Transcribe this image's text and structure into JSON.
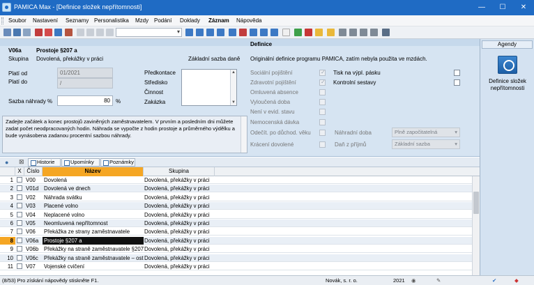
{
  "window": {
    "title": "PAMICA Max - [Definice složek nepřítomnosti]",
    "minimize": "—",
    "maximize": "☐",
    "close": "✕"
  },
  "menu": [
    "Soubor",
    "Nastavení",
    "Seznamy",
    "Personalistika",
    "Mzdy",
    "Podání",
    "Doklady",
    "Záznam",
    "Nápověda"
  ],
  "menu_bold_index": 7,
  "form": {
    "code": "V06a",
    "name": "Prostoje §207 a",
    "group_label": "Skupina",
    "group_value": "Dovolená, překážky v práci",
    "base_label": "Základní sazba daně",
    "definition_heading": "Definice",
    "definition_text": "Originální definice programu PAMICA, zatím nebyla použita ve mzdách.",
    "valid_from_label": "Platí od",
    "valid_from_value": "01/2021",
    "valid_to_label": "Platí do",
    "valid_to_value": "/",
    "sazba_label": "Sazba náhrady %",
    "sazba_value": "80",
    "sazba_unit": "%",
    "side_labels": [
      "Předkontace",
      "Středisko",
      "Činnost",
      "Zakázka"
    ],
    "note_text": "Zadejte začátek a konec prostojů zaviněných zaměstnavatelem. V prvním a posledním dni můžete zadat počet neodpracovaných hodin. Náhrada se vypočte z hodin prostoje a průměrného výdělku a bude vynásobena zadanou procentní sazbou náhrady.",
    "flags": [
      {
        "label": "Sociální pojištění",
        "checked": true
      },
      {
        "label": "Zdravotní pojištění",
        "checked": true
      },
      {
        "label": "Omluvená absence",
        "checked": false
      },
      {
        "label": "Vyloučená doba",
        "checked": false
      },
      {
        "label": "Není v evid. stavu",
        "checked": false
      },
      {
        "label": "Nemocenská dávka",
        "checked": false
      },
      {
        "label": "Odečít. po důchod. věku",
        "checked": false
      },
      {
        "label": "Krácení dovolené",
        "checked": false
      }
    ],
    "print_label": "Tisk na výpl. pásku",
    "control_label": "Kontrolní sestavy",
    "nahradni_doba_label": "Náhradní doba",
    "nahradni_doba_value": "Plně započitatelná",
    "dan_label": "Daň z příjmů",
    "dan_value": "Základní sazba"
  },
  "agendy": {
    "title": "Agendy",
    "item_label": "Definice složek nepřítomnosti",
    "icon": "absence-definition-icon"
  },
  "tabs": [
    "Historie",
    "Upomínky",
    "Poznámky"
  ],
  "table": {
    "headers": {
      "x": "X",
      "code": "Číslo",
      "name": "Název",
      "group": "Skupina"
    },
    "rows": [
      {
        "n": "1",
        "code": "V00",
        "name": "Dovolená",
        "group": "Dovolená, překážky v práci"
      },
      {
        "n": "2",
        "code": "V01d",
        "name": "Dovolená ve dnech",
        "group": "Dovolená, překážky v práci"
      },
      {
        "n": "3",
        "code": "V02",
        "name": "Náhrada svátku",
        "group": "Dovolená, překážky v práci"
      },
      {
        "n": "4",
        "code": "V03",
        "name": "Placené volno",
        "group": "Dovolená, překážky v práci"
      },
      {
        "n": "5",
        "code": "V04",
        "name": "Neplacené volno",
        "group": "Dovolená, překážky v práci"
      },
      {
        "n": "6",
        "code": "V05",
        "name": "Neomluvená nepřítomnost",
        "group": "Dovolená, překážky v práci"
      },
      {
        "n": "7",
        "code": "V06",
        "name": "Překážka ze strany zaměstnavatele",
        "group": "Dovolená, překážky v práci"
      },
      {
        "n": "8",
        "code": "V06a",
        "name": "Prostoje §207 a",
        "group": "Dovolená, překážky v práci"
      },
      {
        "n": "9",
        "code": "V06b",
        "name": "Překážky na straně zaměstnavatele §207 ...",
        "group": "Dovolená, překážky v práci"
      },
      {
        "n": "10",
        "code": "V06c",
        "name": "Překážky na straně zaměstnavatele – ost...",
        "group": "Dovolená, překážky v práci"
      },
      {
        "n": "11",
        "code": "V07",
        "name": "Vojenské cvičení",
        "group": "Dovolená, překážky v práci"
      }
    ],
    "selected_index": 7
  },
  "status": {
    "hint": "(8/53) Pro získání nápovědy stiskněte F1.",
    "company": "Novák, s. r. o.",
    "year": "2021"
  }
}
